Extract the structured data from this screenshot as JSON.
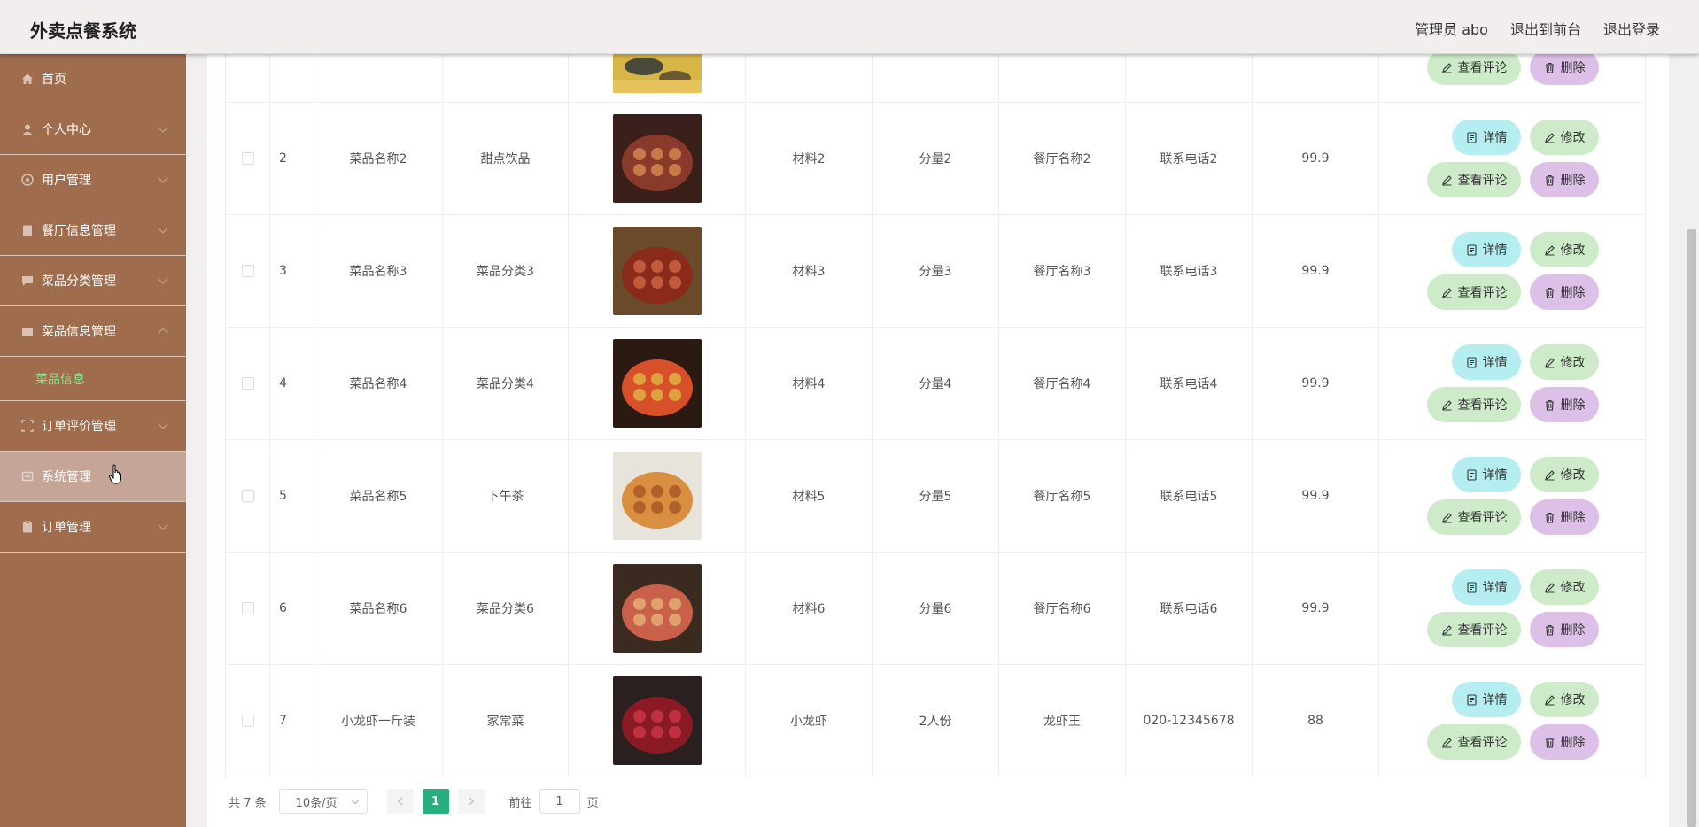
{
  "header": {
    "app_title": "外卖点餐系统",
    "admin_label": "管理员 abo",
    "back_to_front": "退出到前台",
    "logout": "退出登录"
  },
  "sidebar": {
    "items": [
      {
        "label": "首页",
        "icon": "home-icon"
      },
      {
        "label": "个人中心",
        "icon": "user-icon"
      },
      {
        "label": "用户管理",
        "icon": "users-icon"
      },
      {
        "label": "餐厅信息管理",
        "icon": "document-icon"
      },
      {
        "label": "菜品分类管理",
        "icon": "chat-icon"
      },
      {
        "label": "菜品信息管理",
        "icon": "folder-icon"
      },
      {
        "label": "订单评价管理",
        "icon": "frame-icon"
      },
      {
        "label": "系统管理",
        "icon": "settings-icon"
      },
      {
        "label": "订单管理",
        "icon": "clipboard-icon"
      }
    ],
    "subitem_label": "菜品信息"
  },
  "buttons": {
    "detail": "详情",
    "edit": "修改",
    "review": "查看评论",
    "delete": "删除"
  },
  "rows": [
    {
      "idx": "2",
      "name": "菜品名称2",
      "category": "甜点饮品",
      "material": "材料2",
      "portion": "分量2",
      "restaurant": "餐厅名称2",
      "phone": "联系电话2",
      "price": "99.9"
    },
    {
      "idx": "3",
      "name": "菜品名称3",
      "category": "菜品分类3",
      "material": "材料3",
      "portion": "分量3",
      "restaurant": "餐厅名称3",
      "phone": "联系电话3",
      "price": "99.9"
    },
    {
      "idx": "4",
      "name": "菜品名称4",
      "category": "菜品分类4",
      "material": "材料4",
      "portion": "分量4",
      "restaurant": "餐厅名称4",
      "phone": "联系电话4",
      "price": "99.9"
    },
    {
      "idx": "5",
      "name": "菜品名称5",
      "category": "下午茶",
      "material": "材料5",
      "portion": "分量5",
      "restaurant": "餐厅名称5",
      "phone": "联系电话5",
      "price": "99.9"
    },
    {
      "idx": "6",
      "name": "菜品名称6",
      "category": "菜品分类6",
      "material": "材料6",
      "portion": "分量6",
      "restaurant": "餐厅名称6",
      "phone": "联系电话6",
      "price": "99.9"
    },
    {
      "idx": "7",
      "name": "小龙虾一斤装",
      "category": "家常菜",
      "material": "小龙虾",
      "portion": "2人份",
      "restaurant": "龙虾王",
      "phone": "020-12345678",
      "price": "88"
    }
  ],
  "pagination": {
    "total": "共 7 条",
    "page_size": "10条/页",
    "current_page": "1",
    "goto_label": "前往",
    "goto_value": "1",
    "page_suffix": "页"
  },
  "colors": {
    "sidebar_bg": "#a06c4e",
    "active_submenu": "#8fe08a",
    "page_active": "#27b07d",
    "btn_detail": "#b5eef1",
    "btn_edit": "#cdebc9",
    "btn_delete": "#dcc0e8"
  }
}
